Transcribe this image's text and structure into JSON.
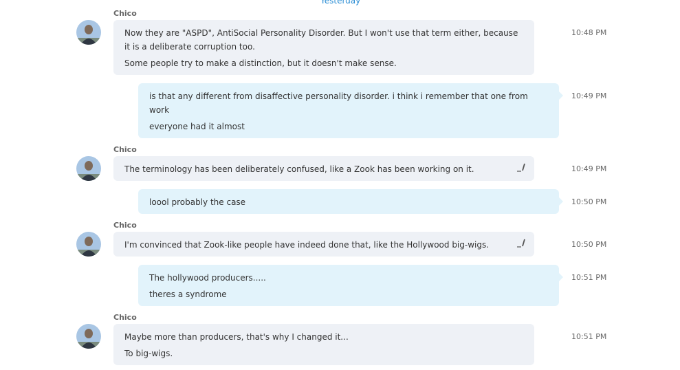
{
  "day_label": "Yesterday",
  "messages": [
    {
      "sender": "Chico",
      "lines": [
        "Now they are \"ASPD\", AntiSocial Personality Disorder.  But I won't use that term either, because",
        "it is a deliberate corruption too.",
        "Some people try to make a distinction, but it doesn't make sense."
      ],
      "time": "10:48 PM"
    },
    {
      "lines": [
        "is that any different from disaffective personality disorder.  i think i remember that one from",
        "work",
        "everyone had it almost"
      ],
      "time": "10:49 PM"
    },
    {
      "sender": "Chico",
      "lines": [
        "The terminology has been deliberately confused, like a Zook has been working on it."
      ],
      "edited_icon": "edit-pencil-icon",
      "time": "10:49 PM"
    },
    {
      "lines": [
        "loool  probably the case"
      ],
      "time": "10:50 PM"
    },
    {
      "sender": "Chico",
      "lines": [
        "I'm convinced that Zook-like people have indeed done that, like the Hollywood big-wigs."
      ],
      "edited_icon": "edit-pencil-icon",
      "time": "10:50 PM"
    },
    {
      "lines": [
        "The hollywood producers.....",
        "theres a syndrome"
      ],
      "time": "10:51 PM"
    },
    {
      "sender": "Chico",
      "lines": [
        "Maybe more than producers, that's why I changed it...",
        "To big-wigs."
      ],
      "time": "10:51 PM"
    }
  ],
  "colors": {
    "incoming_bubble": "#eef1f6",
    "outgoing_bubble": "#e2f3fb",
    "day_label": "#2a8dd4"
  }
}
